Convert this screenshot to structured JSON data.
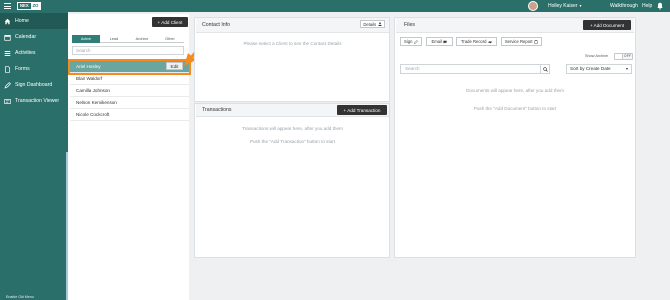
{
  "topbar": {
    "logo_left": "NEX",
    "logo_right": "ZO",
    "user_name": "Holley Kaiser",
    "walkthrough": "Walkthrough",
    "help": "Help"
  },
  "sidebar": {
    "items": [
      {
        "label": "Home",
        "icon": "home-icon"
      },
      {
        "label": "Calendar",
        "icon": "calendar-icon"
      },
      {
        "label": "Activities",
        "icon": "activities-icon"
      },
      {
        "label": "Forms",
        "icon": "forms-icon"
      },
      {
        "label": "Sign Dashboard",
        "icon": "sign-icon"
      },
      {
        "label": "Transaction Viewer",
        "icon": "transaction-icon"
      }
    ],
    "footer": "Enable Old Menu"
  },
  "clients": {
    "add_button": "+ Add Client",
    "tabs": [
      "Active",
      "Lead",
      "Archive",
      "Other"
    ],
    "search_placeholder": "Search",
    "rows": [
      "Ariel Hosley",
      "Blair Waldorf",
      "Camilla Johnson",
      "Nelson Kemikenson",
      "Nicole Cockcroft"
    ],
    "edit_label": "Edit"
  },
  "contact_info": {
    "title": "Contact Info",
    "details_label": "Details",
    "empty_text": "Please select a Client to see the Contact Details"
  },
  "transactions": {
    "title": "Transactions",
    "add_button": "+ Add Transaction",
    "empty_line1": "Transactions will appear here, after you add them",
    "empty_line2": "Push the \"Add Transaction\" button to start"
  },
  "files": {
    "title": "Files",
    "add_button": "+ Add Document",
    "tools": [
      "Sign",
      "Email",
      "Trade Record",
      "Service Report"
    ],
    "show_archive": "Show Archive",
    "toggle_state": "OFF",
    "search_placeholder": "Search",
    "sort_value": "Sort by Create Date",
    "empty_line1": "Documents will appear here, after you add them",
    "empty_line2": "Push the \"Add Document\" button to start"
  },
  "colors": {
    "brand_teal": "#2b6f6a",
    "selected_row": "#6aa59f",
    "highlight_orange": "#f58a1f",
    "dark_button": "#333333"
  }
}
